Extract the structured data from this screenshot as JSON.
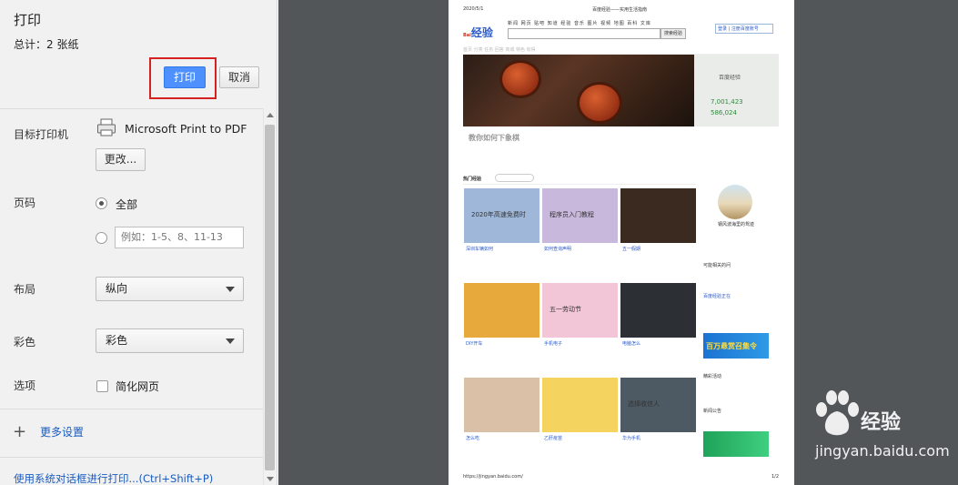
{
  "header": {
    "title": "打印",
    "total": "总计：2 张纸"
  },
  "actions": {
    "print_label": "打印",
    "cancel_label": "取消",
    "highlight_color": "#d62121"
  },
  "destination": {
    "label": "目标打印机",
    "printer_name": "Microsoft Print to PDF",
    "change_label": "更改..."
  },
  "pages": {
    "label": "页码",
    "all_label": "全部",
    "range_placeholder": "例如：1-5、8、11-13"
  },
  "layout": {
    "label": "布局",
    "value": "纵向"
  },
  "color": {
    "label": "彩色",
    "value": "彩色"
  },
  "options": {
    "label": "选项",
    "simplify_label": "简化网页"
  },
  "more_settings": "更多设置",
  "system_dialog": "使用系统对话框进行打印...(Ctrl+Shift+P)",
  "preview": {
    "date": "2020/5/1",
    "page_title": "百度经验——实用生活指南",
    "logo_main": "Bai",
    "logo_tail": "经验",
    "nav_links": "新闻 网页 贴吧 知道 经验 音乐 图片 视频 地图 百科 文库",
    "search_button": "搜索经验",
    "login_hint": "登录 | 注册百度账号",
    "categories": "首页 分类 任务 回答 商城 特色 有得",
    "hero_side_title": "百度经验",
    "stat1": "7,001,423",
    "stat2": "586,024",
    "hero_caption": "教你如何下象棋",
    "hot_label": "热门经验",
    "thumbs": [
      {
        "text": "2020年高速免费时",
        "title": "深圳车辆如何",
        "color": "#9fb7d8"
      },
      {
        "text": "程序员入门教程",
        "title": "如何查询声明",
        "color": "#c8b9dc"
      },
      {
        "text": "",
        "title": "五一假期",
        "color": "#3a2a20"
      },
      {
        "text": "",
        "title": "DIY开车",
        "color": "#e8a93c"
      },
      {
        "text": "五一劳动节",
        "title": "手机电子",
        "color": "#f2c6d6"
      },
      {
        "text": "",
        "title": "电脑怎么",
        "color": "#2c2f33"
      },
      {
        "text": "",
        "title": "怎么吃",
        "color": "#d9c0a6"
      },
      {
        "text": "",
        "title": "乙肝疫苗",
        "color": "#f4d35e"
      },
      {
        "text": "选择收信人",
        "title": "华为手机",
        "color": "#4d5a63"
      }
    ],
    "profile_name": "钢风波海里的鸳迹",
    "right_sections": [
      "可能相关的问",
      "百度经验正在",
      "精彩活动",
      "新闻公告"
    ],
    "ad1_text": "百万悬赏召集令",
    "url": "https://jingyan.baidu.com/",
    "page_num": "1/2"
  },
  "watermark": {
    "brand": "经验",
    "domain": "jingyan.baidu.com"
  }
}
